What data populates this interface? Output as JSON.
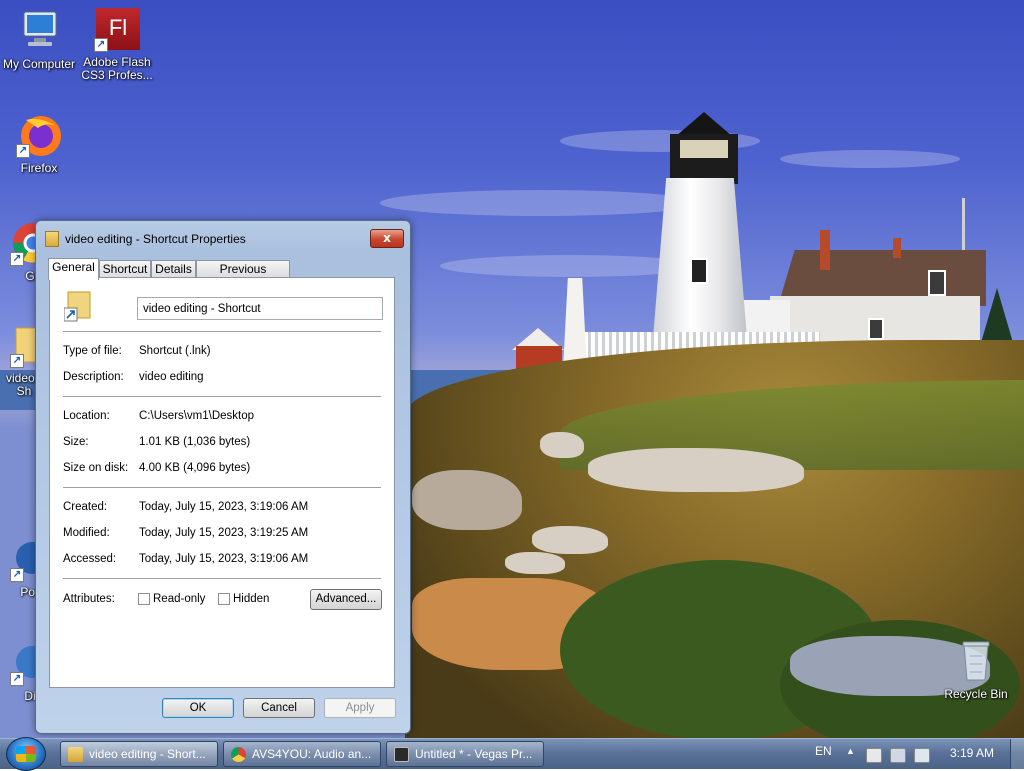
{
  "desktop": {
    "icons": [
      {
        "label": "My Computer",
        "icon": "computer-icon"
      },
      {
        "label": "Adobe Flash CS3 Profes...",
        "icon": "flash-icon",
        "glyph": "Fl"
      },
      {
        "label": "Firefox",
        "icon": "firefox-icon"
      },
      {
        "label": "Go Chi",
        "icon": "chrome-icon"
      },
      {
        "label": "video - Sh",
        "icon": "folder-shortcut-icon"
      },
      {
        "label": "Pow",
        "icon": "app-icon"
      },
      {
        "label": "Dis",
        "icon": "app-icon"
      },
      {
        "label": "Recycle Bin",
        "icon": "recycle-bin-icon"
      }
    ]
  },
  "dialog": {
    "title": "video editing - Shortcut Properties",
    "close_glyph": "x",
    "tabs": [
      {
        "label": "General",
        "active": true
      },
      {
        "label": "Shortcut",
        "active": false
      },
      {
        "label": "Details",
        "active": false
      },
      {
        "label": "Previous Versions",
        "active": false
      }
    ],
    "name_value": "video editing - Shortcut",
    "fields": {
      "type_label": "Type of file:",
      "type_value": "Shortcut (.lnk)",
      "desc_label": "Description:",
      "desc_value": "video editing",
      "location_label": "Location:",
      "location_value": "C:\\Users\\vm1\\Desktop",
      "size_label": "Size:",
      "size_value": "1.01 KB (1,036 bytes)",
      "sizedisk_label": "Size on disk:",
      "sizedisk_value": "4.00 KB (4,096 bytes)",
      "created_label": "Created:",
      "created_value": "Today, July 15, 2023, 3:19:06 AM",
      "modified_label": "Modified:",
      "modified_value": "Today, July 15, 2023, 3:19:25 AM",
      "accessed_label": "Accessed:",
      "accessed_value": "Today, July 15, 2023, 3:19:06 AM",
      "attributes_label": "Attributes:"
    },
    "readonly_label": "Read-only",
    "readonly_checked": false,
    "hidden_label": "Hidden",
    "hidden_checked": false,
    "advanced_label": "Advanced...",
    "ok_label": "OK",
    "cancel_label": "Cancel",
    "apply_label": "Apply"
  },
  "taskbar": {
    "items": [
      {
        "label": "video editing - Short...",
        "active": true,
        "icon": "folder-icon"
      },
      {
        "label": "AVS4YOU: Audio an...",
        "active": false,
        "icon": "chrome-icon"
      },
      {
        "label": "Untitled * - Vegas Pr...",
        "active": false,
        "icon": "vegas-icon"
      }
    ],
    "language": "EN",
    "clock": "3:19 AM"
  }
}
